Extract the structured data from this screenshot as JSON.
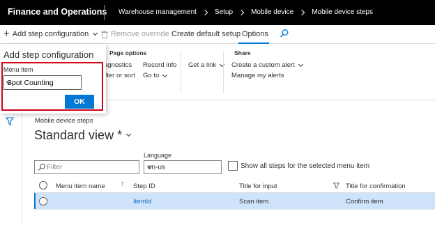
{
  "app": {
    "title": "Finance and Operations"
  },
  "breadcrumbs": [
    "Warehouse management",
    "Setup",
    "Mobile device",
    "Mobile device steps"
  ],
  "action_pane": {
    "add_step_config": "Add step configuration",
    "remove_override": "Remove override",
    "create_default_setup": "Create default setup",
    "options": "Options"
  },
  "options_ribbon": {
    "page_options_title": "Page options",
    "diagnostics": "agnostics",
    "filter_or_sort": "ilter or sort",
    "record_info": "Record info",
    "go_to": "Go to",
    "get_a_link": "Get a link",
    "share_title": "Share",
    "create_custom_alert": "Create a custom alert",
    "manage_alerts": "Manage my alerts"
  },
  "flyout": {
    "title": "Add step configuration",
    "menu_item_label": "Menu Item",
    "menu_item_value": "Spot Counting",
    "ok_label": "OK"
  },
  "main": {
    "section_label": "Mobile device steps",
    "view_title": "Standard view *",
    "filter_placeholder": "Filter",
    "language_label": "Language",
    "language_value": "en-us",
    "show_all_steps_label": "Show all steps for the selected menu item"
  },
  "grid": {
    "columns": [
      "Menu item name",
      "Step ID",
      "Title for input",
      "Title for confirmation"
    ],
    "rows": [
      {
        "menu_item_name": "",
        "step_id": "ItemId",
        "title_for_input": "Scan item",
        "title_for_confirmation": "Confirm item"
      }
    ]
  },
  "colors": {
    "topbar": "#000000",
    "accent": "#0078d4",
    "highlight_box": "#d0021b",
    "selected_row": "#cfe4fa"
  }
}
